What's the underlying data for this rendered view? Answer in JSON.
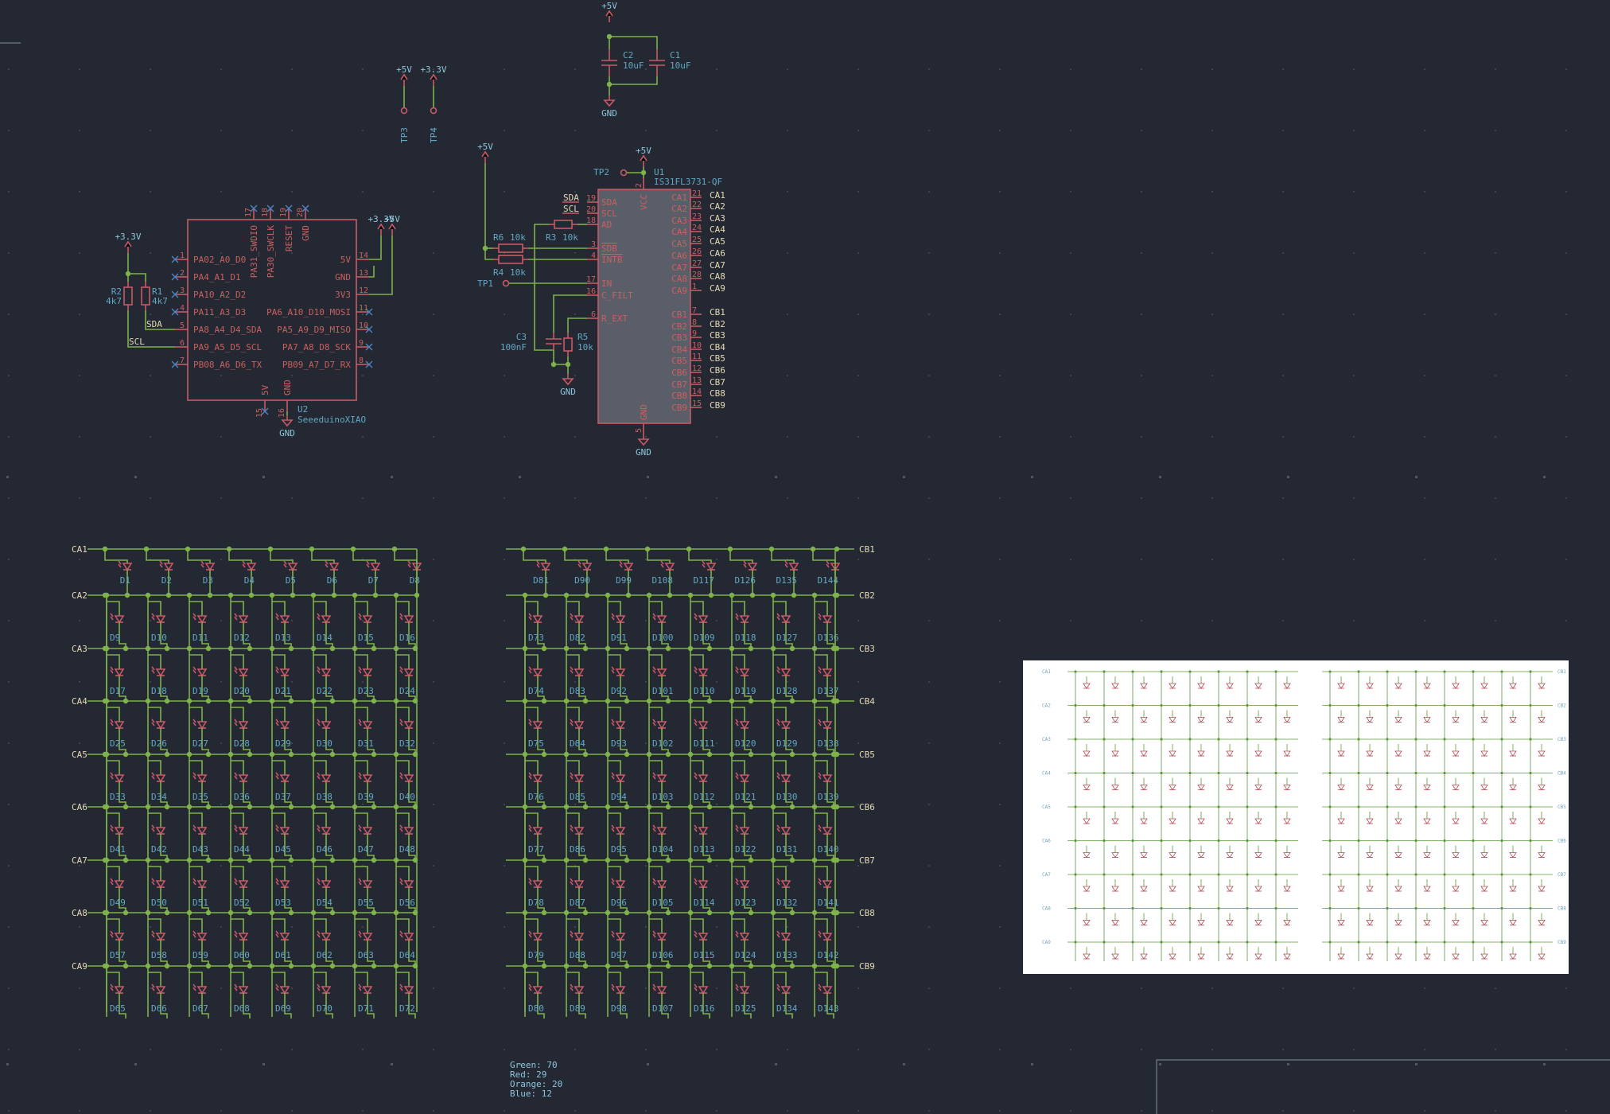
{
  "power": {
    "p5v": "+5V",
    "p3v3": "+3.3V",
    "gnd": "GND"
  },
  "caps": [
    {
      "ref": "C2",
      "val": "10uF"
    },
    {
      "ref": "C1",
      "val": "10uF"
    },
    {
      "ref": "C3",
      "val": "100nF"
    }
  ],
  "testpoints": [
    "TP3",
    "TP4",
    "TP2",
    "TP1"
  ],
  "resistors": [
    {
      "ref": "R2",
      "val": "4k7"
    },
    {
      "ref": "R1",
      "val": "4k7"
    },
    {
      "ref": "R6",
      "val": "10k"
    },
    {
      "ref": "R3",
      "val": "10k"
    },
    {
      "ref": "R4",
      "val": "10k"
    },
    {
      "ref": "R5",
      "val": "10k"
    }
  ],
  "u1": {
    "ref": "U1",
    "val": "IS31FL3731-QF",
    "left_pins": [
      {
        "num": "19",
        "name": "SDA"
      },
      {
        "num": "20",
        "name": "SCL"
      },
      {
        "num": "18",
        "name": "AD"
      },
      {
        "num": "3",
        "name": "SDB"
      },
      {
        "num": "4",
        "name": "INTB"
      },
      {
        "num": "17",
        "name": "IN"
      },
      {
        "num": "16",
        "name": "C_FILT"
      },
      {
        "num": "6",
        "name": "R_EXT"
      }
    ],
    "right_pins_a": [
      {
        "num": "21",
        "name": "CA1"
      },
      {
        "num": "22",
        "name": "CA2"
      },
      {
        "num": "23",
        "name": "CA3"
      },
      {
        "num": "24",
        "name": "CA4"
      },
      {
        "num": "25",
        "name": "CA5"
      },
      {
        "num": "26",
        "name": "CA6"
      },
      {
        "num": "27",
        "name": "CA7"
      },
      {
        "num": "28",
        "name": "CA8"
      },
      {
        "num": "1",
        "name": "CA9"
      }
    ],
    "right_pins_b": [
      {
        "num": "7",
        "name": "CB1"
      },
      {
        "num": "8",
        "name": "CB2"
      },
      {
        "num": "9",
        "name": "CB3"
      },
      {
        "num": "10",
        "name": "CB4"
      },
      {
        "num": "11",
        "name": "CB5"
      },
      {
        "num": "12",
        "name": "CB6"
      },
      {
        "num": "13",
        "name": "CB7"
      },
      {
        "num": "14",
        "name": "CB8"
      },
      {
        "num": "15",
        "name": "CB9"
      }
    ],
    "vcc": {
      "num": "2",
      "name": "VCC"
    },
    "gnd": {
      "num": "5",
      "name": "GND"
    }
  },
  "u2": {
    "ref": "U2",
    "val": "SeeeduinoXIAO",
    "left_pins": [
      {
        "num": "1",
        "name": "PA02_A0_D0"
      },
      {
        "num": "2",
        "name": "PA4_A1_D1"
      },
      {
        "num": "3",
        "name": "PA10_A2_D2"
      },
      {
        "num": "4",
        "name": "PA11_A3_D3"
      },
      {
        "num": "5",
        "name": "PA8_A4_D4_SDA"
      },
      {
        "num": "6",
        "name": "PA9_A5_D5_SCL"
      },
      {
        "num": "7",
        "name": "PB08_A6_D6_TX"
      }
    ],
    "right_pins": [
      {
        "num": "14",
        "name": "5V"
      },
      {
        "num": "13",
        "name": "GND"
      },
      {
        "num": "12",
        "name": "3V3"
      },
      {
        "num": "11",
        "name": "PA6_A10_D10_MOSI"
      },
      {
        "num": "10",
        "name": "PA5_A9_D9_MISO"
      },
      {
        "num": "9",
        "name": "PA7_A8_D8_SCK"
      },
      {
        "num": "8",
        "name": "PB09_A7_D7_RX"
      }
    ],
    "top_pins": [
      {
        "num": "17",
        "name": "PA31_SWDIO"
      },
      {
        "num": "18",
        "name": "PA30_SWCLK"
      },
      {
        "num": "19",
        "name": "RESET"
      },
      {
        "num": "20",
        "name": "GND"
      }
    ],
    "bottom_pins": [
      {
        "num": "15",
        "name": "5V"
      },
      {
        "num": "16",
        "name": "GND"
      }
    ]
  },
  "netlabels": {
    "sda": "SDA",
    "scl": "SCL"
  },
  "matrix": {
    "a_nets": [
      "CA1",
      "CA2",
      "CA3",
      "CA4",
      "CA5",
      "CA6",
      "CA7",
      "CA8",
      "CA9"
    ],
    "b_nets": [
      "CB1",
      "CB2",
      "CB3",
      "CB4",
      "CB5",
      "CB6",
      "CB7",
      "CB8",
      "CB9"
    ],
    "a_labels": [
      [
        "D1",
        "D2",
        "D3",
        "D4",
        "D5",
        "D6",
        "D7",
        "D8"
      ],
      [
        "D9",
        "D10",
        "D11",
        "D12",
        "D13",
        "D14",
        "D15",
        "D16"
      ],
      [
        "D17",
        "D18",
        "D19",
        "D20",
        "D21",
        "D22",
        "D23",
        "D24"
      ],
      [
        "D25",
        "D26",
        "D27",
        "D28",
        "D29",
        "D30",
        "D31",
        "D32"
      ],
      [
        "D33",
        "D34",
        "D35",
        "D36",
        "D37",
        "D38",
        "D39",
        "D40"
      ],
      [
        "D41",
        "D42",
        "D43",
        "D44",
        "D45",
        "D46",
        "D47",
        "D48"
      ],
      [
        "D49",
        "D50",
        "D51",
        "D52",
        "D53",
        "D54",
        "D55",
        "D56"
      ],
      [
        "D57",
        "D58",
        "D59",
        "D60",
        "D61",
        "D62",
        "D63",
        "D64"
      ],
      [
        "D65",
        "D66",
        "D67",
        "D68",
        "D69",
        "D70",
        "D71",
        "D72"
      ]
    ],
    "b_labels": [
      [
        "D81",
        "D90",
        "D99",
        "D108",
        "D117",
        "D126",
        "D135",
        "D144"
      ],
      [
        "D73",
        "D82",
        "D91",
        "D100",
        "D109",
        "D118",
        "D127",
        "D136"
      ],
      [
        "D74",
        "D83",
        "D92",
        "D101",
        "D110",
        "D119",
        "D128",
        "D137"
      ],
      [
        "D75",
        "D84",
        "D93",
        "D102",
        "D111",
        "D120",
        "D129",
        "D138"
      ],
      [
        "D76",
        "D85",
        "D94",
        "D103",
        "D112",
        "D121",
        "D130",
        "D139"
      ],
      [
        "D77",
        "D86",
        "D95",
        "D104",
        "D113",
        "D122",
        "D131",
        "D140"
      ],
      [
        "D78",
        "D87",
        "D96",
        "D105",
        "D114",
        "D123",
        "D132",
        "D141"
      ],
      [
        "D79",
        "D88",
        "D97",
        "D106",
        "D115",
        "D124",
        "D133",
        "D142"
      ],
      [
        "D80",
        "D89",
        "D98",
        "D107",
        "D116",
        "D125",
        "D134",
        "D143"
      ]
    ]
  },
  "legend_stats": [
    {
      "label": "Green: 70"
    },
    {
      "label": "Red: 29"
    },
    {
      "label": "Orange: 20"
    },
    {
      "label": "Blue: 12"
    }
  ],
  "colors": {
    "background": "#232833",
    "wire": "#7fb24a",
    "symbol": "#c75a66",
    "reference": "#63a8c4",
    "label": "#e5d9b3",
    "ic_fill": "#5a5e68"
  }
}
